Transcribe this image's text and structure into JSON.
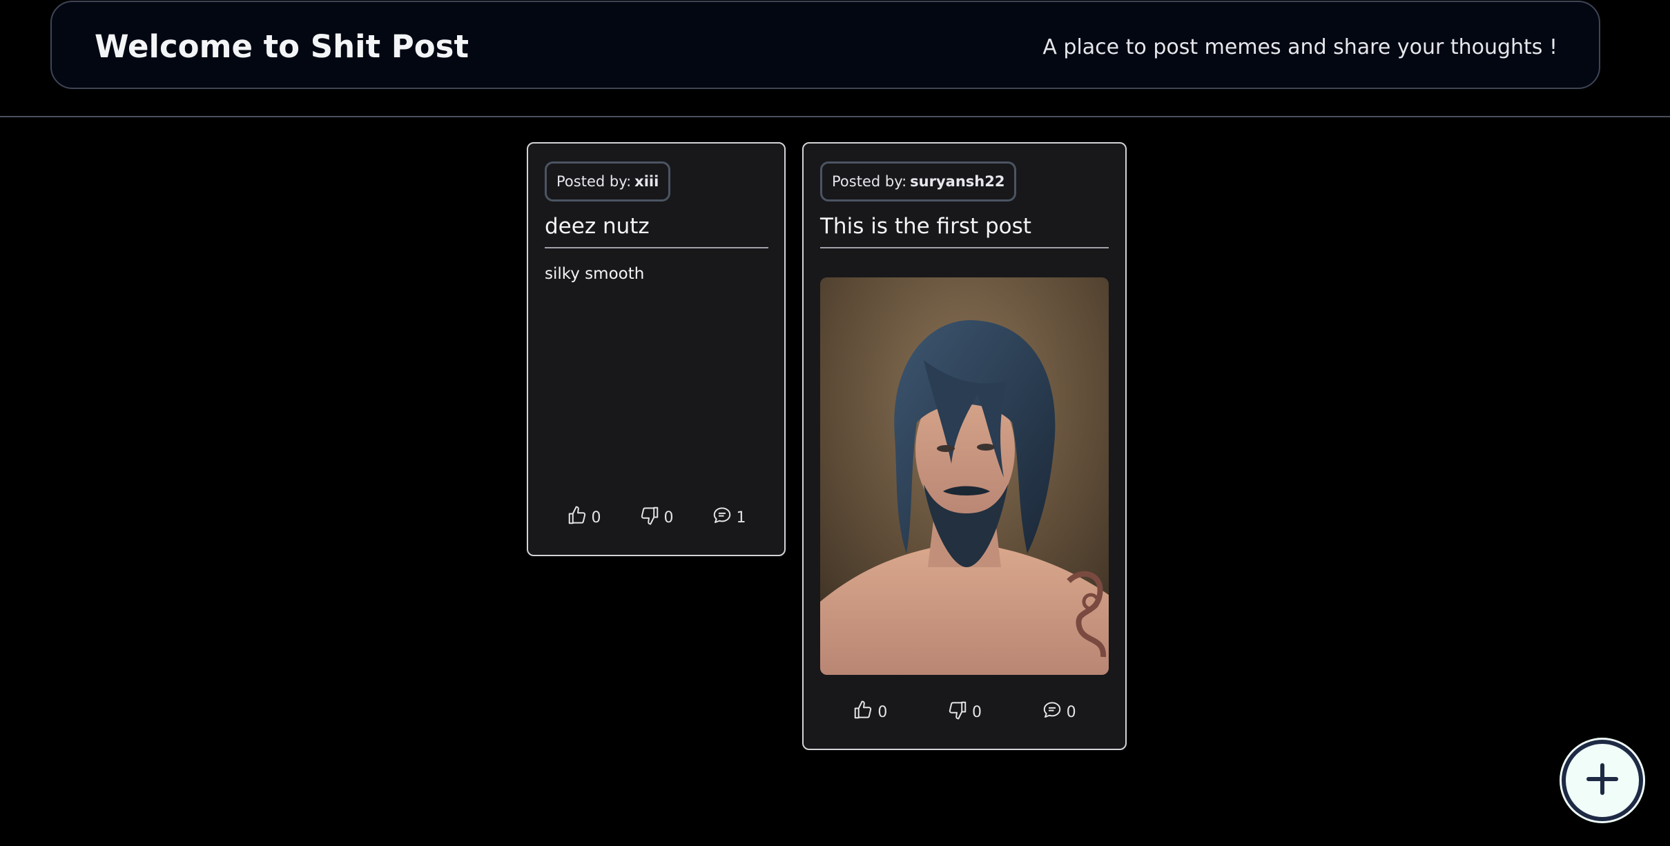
{
  "header": {
    "title": "Welcome to Shit Post",
    "tagline": "A place to post memes and share your thoughts !"
  },
  "posts": [
    {
      "author_prefix": "Posted by:",
      "author": "xiii",
      "title": "deez nutz",
      "body": "silky smooth",
      "likes": "0",
      "dislikes": "0",
      "comments": "1"
    },
    {
      "author_prefix": "Posted by:",
      "author": "suryansh22",
      "title": "This is the first post",
      "image": "painted portrait of a man with blue-black hair and beard",
      "likes": "0",
      "dislikes": "0",
      "comments": "0"
    }
  ],
  "fab": {
    "icon": "plus-circle-icon"
  },
  "colors": {
    "background": "#000000",
    "header_bg": "#030712",
    "card_bg": "#18181b",
    "card_border": "#d4d4d8",
    "fab_bg": "#f0fdf9",
    "fab_icon": "#1e2a44"
  }
}
